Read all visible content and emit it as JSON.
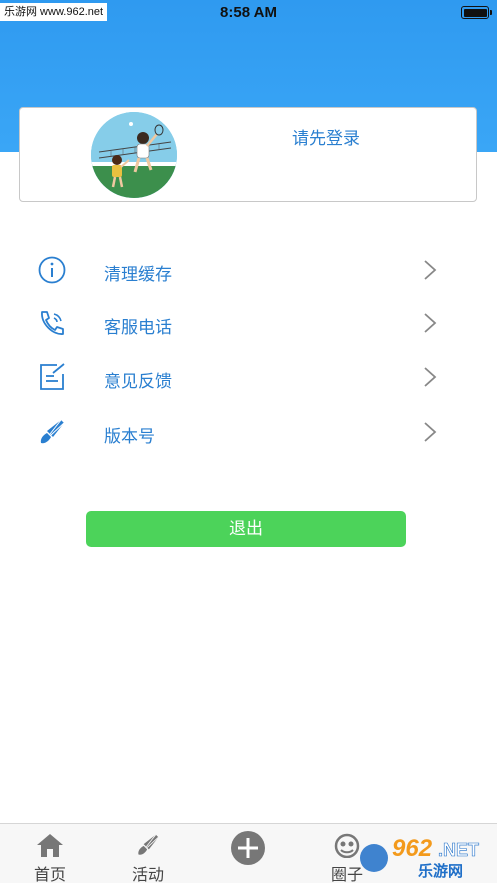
{
  "status_bar": {
    "watermark": "乐游网 www.962.net",
    "time": "8:58 AM"
  },
  "header": {
    "login_prompt": "请先登录",
    "avatar_icon": "badminton-players-avatar"
  },
  "menu": {
    "items": [
      {
        "label": "清理缓存",
        "icon": "info-icon"
      },
      {
        "label": "客服电话",
        "icon": "phone-icon"
      },
      {
        "label": "意见反馈",
        "icon": "feedback-edit-icon"
      },
      {
        "label": "版本号",
        "icon": "shuttlecock-icon"
      }
    ],
    "chevron_icon": "chevron-right-icon"
  },
  "logout": {
    "label": "退出"
  },
  "tabbar": {
    "tabs": [
      {
        "label": "首页",
        "icon": "home-icon"
      },
      {
        "label": "活动",
        "icon": "shuttlecock-icon"
      },
      {
        "label": "",
        "icon": "plus-circle-icon"
      },
      {
        "label": "圈子",
        "icon": "group-icon"
      }
    ],
    "watermark_text": "962.NET 乐游网"
  },
  "colors": {
    "header_blue": "#3aa6f6",
    "accent_text": "#2a7fd0",
    "logout_green": "#4cd35a"
  }
}
